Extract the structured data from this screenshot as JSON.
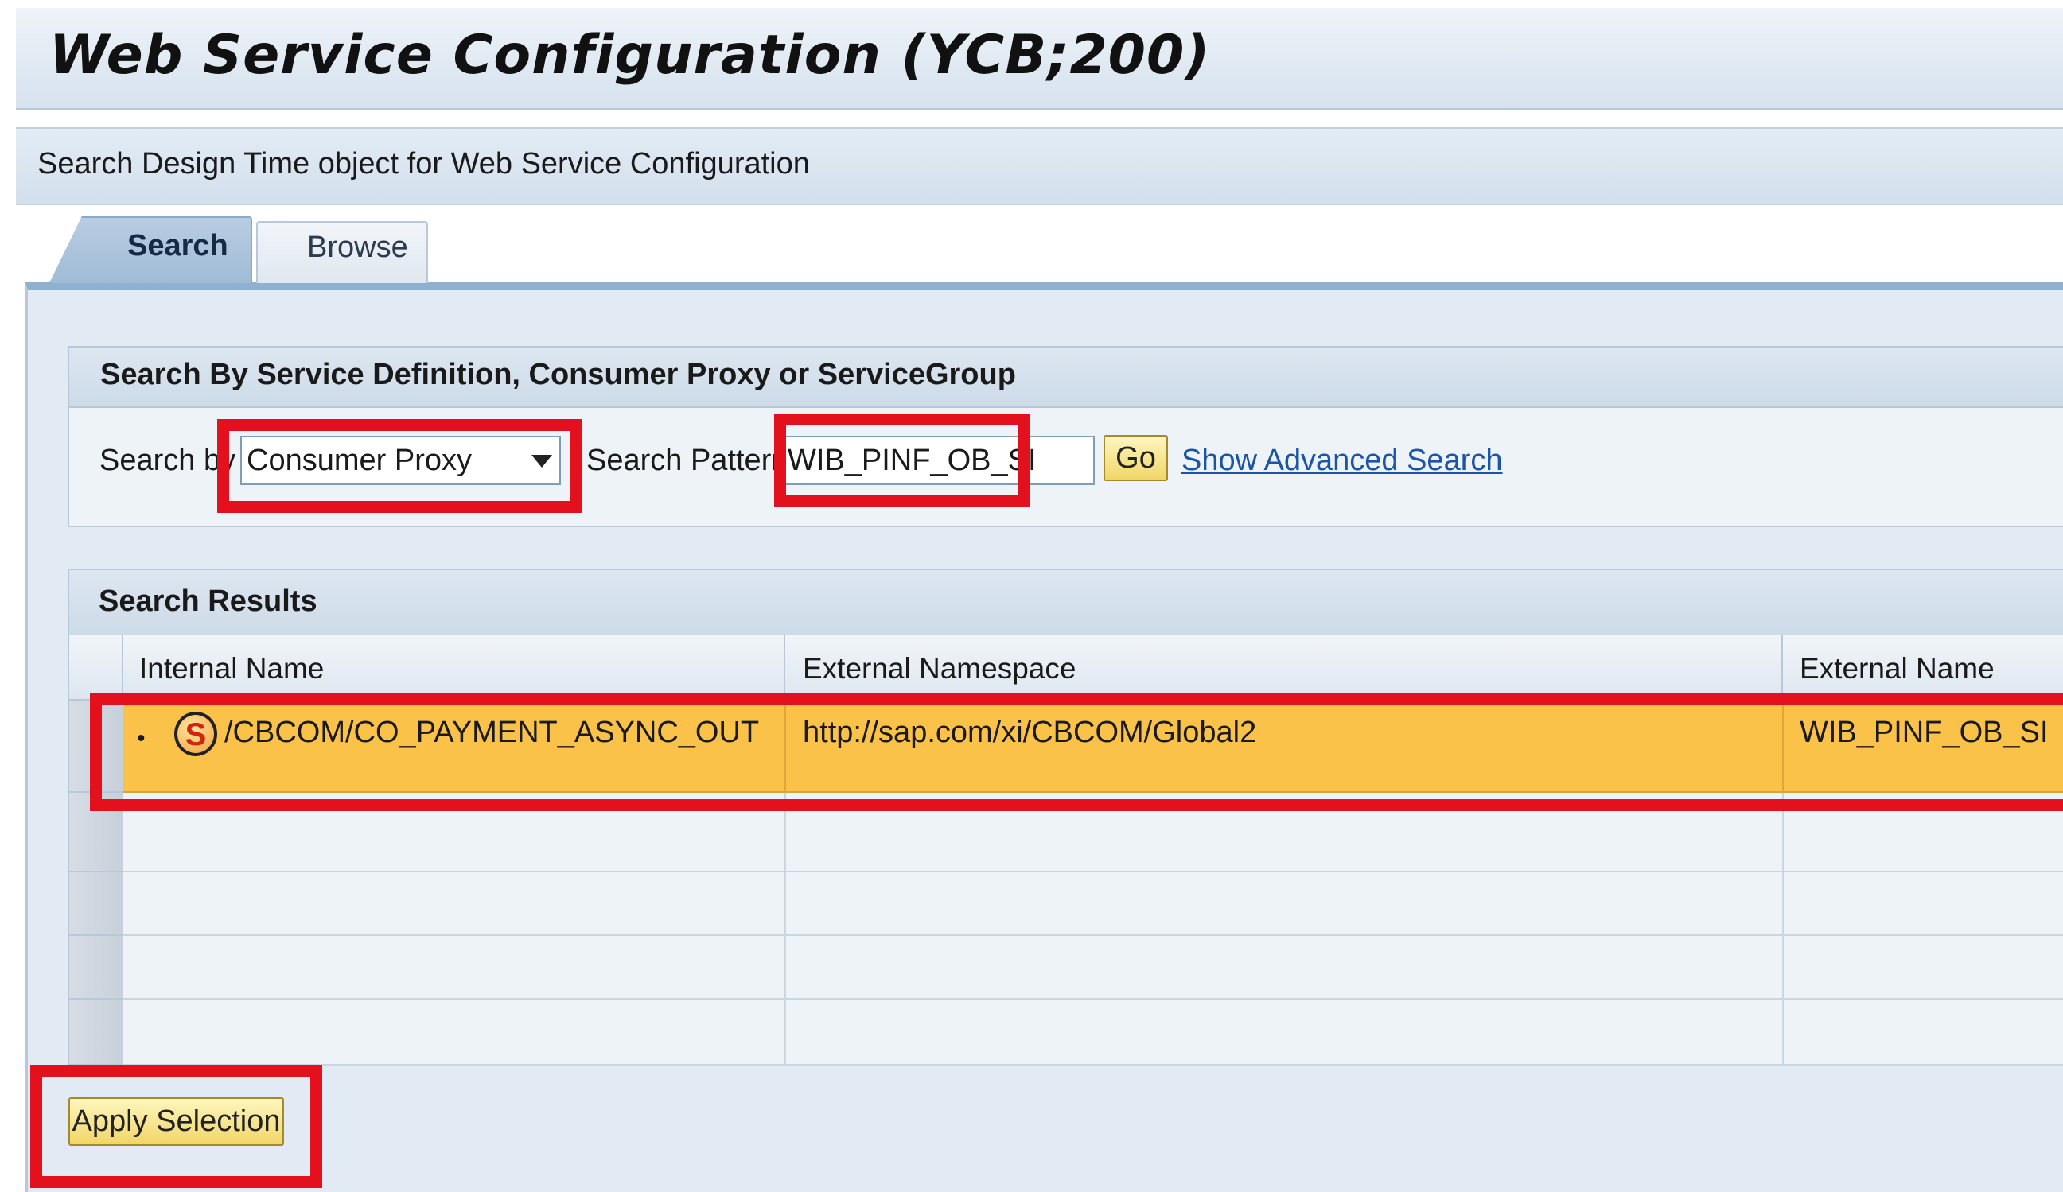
{
  "page": {
    "title": "Web Service Configuration (YCB;200)",
    "subtitle": "Search Design Time object for Web Service Configuration"
  },
  "tabs": [
    {
      "label": "Search",
      "active": true
    },
    {
      "label": "Browse",
      "active": false
    }
  ],
  "search_group": {
    "title": "Search By Service Definition, Consumer Proxy or ServiceGroup",
    "search_by_label": "Search by",
    "search_by_value": "Consumer Proxy",
    "search_pattern_label": "Search Pattern:",
    "search_pattern_value": "WIB_PINF_OB_SI",
    "go_label": "Go",
    "advanced_link": "Show Advanced Search"
  },
  "results": {
    "title": "Search Results",
    "columns": [
      "Internal Name",
      "External Namespace",
      "External Name"
    ],
    "rows": [
      {
        "bullet": "•",
        "icon": "service-definition-icon",
        "icon_letter": "S",
        "internal_name": "/CBCOM/CO_PAYMENT_ASYNC_OUT",
        "external_namespace": "http://sap.com/xi/CBCOM/Global2",
        "external_name": "WIB_PINF_OB_SI",
        "selected": true
      }
    ]
  },
  "apply_label": "Apply Selection",
  "colors": {
    "highlight": "#e3111d",
    "selected_row": "#fbc24a",
    "panel": "#e2ebf4",
    "link": "#1a55a8",
    "button": "#f0d668"
  }
}
